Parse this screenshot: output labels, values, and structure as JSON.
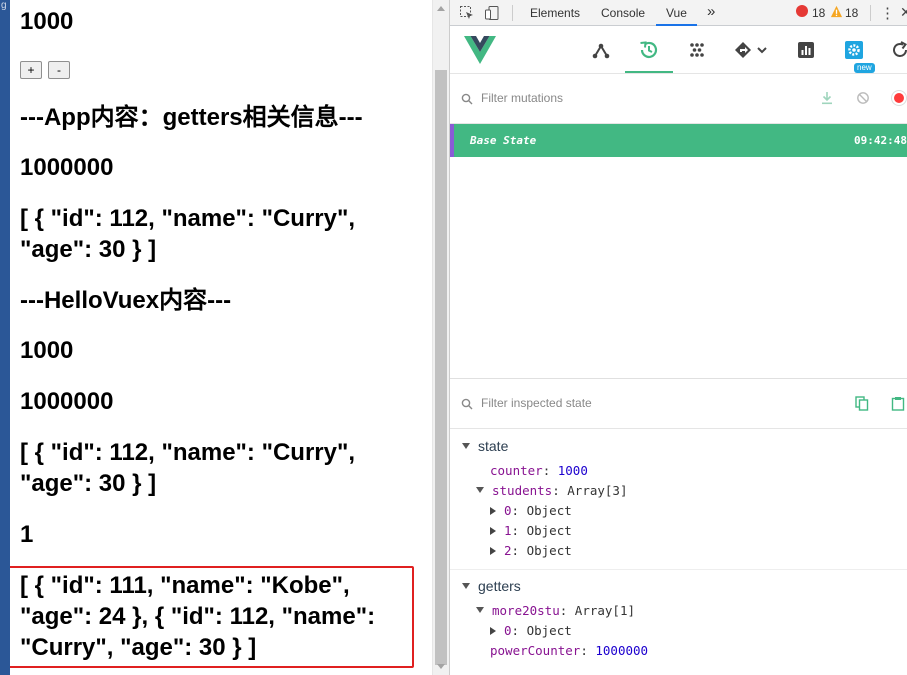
{
  "app": {
    "counter": "1000",
    "inc_label": "+",
    "dec_label": "-",
    "heading_app": "---App内容：getters相关信息---",
    "power_counter": "1000000",
    "more20_line1": "[ { \"id\": 112, \"name\": \"Curry\",",
    "more20_line2": "\"age\": 30 } ]",
    "heading_hello": "---HelloVuex内容---",
    "hello_counter": "1000",
    "hello_power": "1000000",
    "hello_more_line1": "[ { \"id\": 112, \"name\": \"Curry\",",
    "hello_more_line2": "\"age\": 30 } ]",
    "count_value": "1",
    "students_line1": "[ { \"id\": 111, \"name\": \"Kobe\",",
    "students_line2": "\"age\": 24 }, { \"id\": 112, \"name\":",
    "students_line3": "\"Curry\", \"age\": 30 } ]"
  },
  "devtools": {
    "tabs": [
      "Elements",
      "Console",
      "Vue"
    ],
    "more_tabs": "»",
    "errors_count": "18",
    "warnings_count": "18",
    "new_badge": "new",
    "filter_mutations_placeholder": "Filter mutations",
    "base_state_label": "Base State",
    "base_state_time": "09:42:48",
    "filter_state_placeholder": "Filter inspected state",
    "state_section": "state",
    "counter_key": "counter",
    "counter_val": "1000",
    "students_key": "students",
    "students_val": "Array[3]",
    "student_items": [
      {
        "key": "0",
        "val": "Object"
      },
      {
        "key": "1",
        "val": "Object"
      },
      {
        "key": "2",
        "val": "Object"
      }
    ],
    "getters_section": "getters",
    "more20stu_key": "more20stu",
    "more20stu_val": "Array[1]",
    "more20_item_key": "0",
    "more20_item_val": "Object",
    "powercounter_key": "powerCounter",
    "powercounter_val": "1000000"
  },
  "colors": {
    "accent": "#42b883",
    "highlight_border": "#e02020",
    "record_red": "#ff3b3b"
  }
}
